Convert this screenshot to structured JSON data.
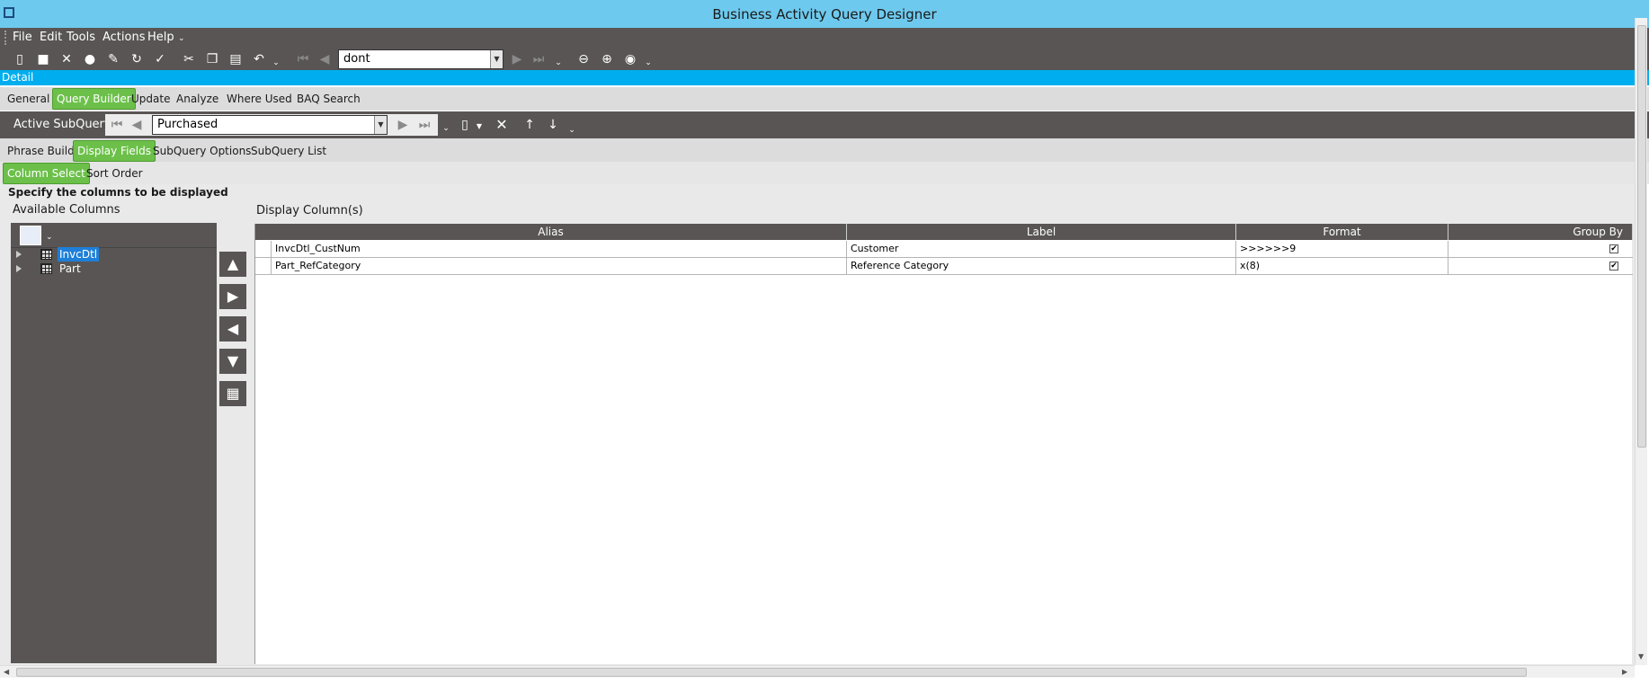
{
  "window": {
    "title": "Business Activity Query Designer"
  },
  "menu": {
    "items": [
      "File",
      "Edit",
      "Tools",
      "Actions",
      "Help"
    ]
  },
  "toolbar": {
    "record_value": "dont"
  },
  "detail_bar": {
    "label": "Detail"
  },
  "main_tabs": [
    "General",
    "Query Builder",
    "Update",
    "Analyze",
    "Where Used",
    "BAQ Search"
  ],
  "subquery": {
    "label": "Active SubQuery:",
    "value": "Purchased"
  },
  "sub_tabs": [
    "Phrase Build",
    "Display Fields",
    "SubQuery Options",
    "SubQuery List"
  ],
  "field_tabs": [
    "Column Select",
    "Sort Order"
  ],
  "instructions": "Specify the columns to be displayed",
  "available": {
    "label": "Available Columns",
    "tables": [
      {
        "name": "InvcDtl",
        "selected": true
      },
      {
        "name": "Part",
        "selected": false
      }
    ]
  },
  "display": {
    "label": "Display Column(s)",
    "columns": [
      "Alias",
      "Label",
      "Format",
      "Group By"
    ],
    "rows": [
      {
        "alias": "InvcDtl_CustNum",
        "label": "Customer",
        "format": ">>>>>>9",
        "group_by": "✔"
      },
      {
        "alias": "Part_RefCategory",
        "label": "Reference Category",
        "format": "x(8)",
        "group_by": "✔"
      }
    ]
  },
  "colors": {
    "dark": "#595555",
    "title": "#6ec9ee",
    "accent": "#00aeef",
    "active_tab": "#6cc04a"
  }
}
